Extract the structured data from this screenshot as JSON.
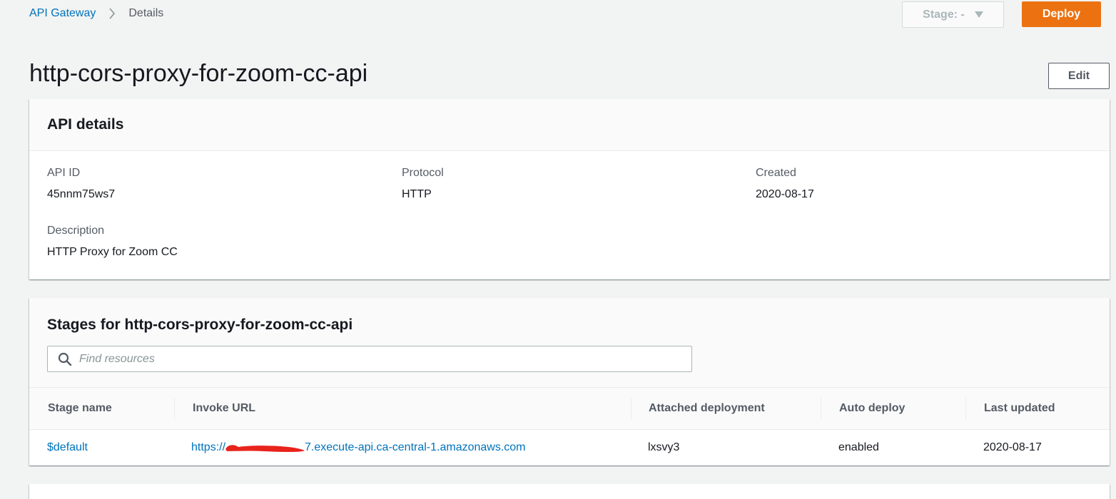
{
  "breadcrumb": {
    "root": "API Gateway",
    "current": "Details"
  },
  "toolbar": {
    "stage_label": "Stage: -",
    "deploy_label": "Deploy"
  },
  "page": {
    "title": "http-cors-proxy-for-zoom-cc-api",
    "edit_label": "Edit"
  },
  "api_details": {
    "title": "API details",
    "api_id_label": "API ID",
    "api_id": "45nnm75ws7",
    "protocol_label": "Protocol",
    "protocol": "HTTP",
    "created_label": "Created",
    "created": "2020-08-17",
    "description_label": "Description",
    "description": "HTTP Proxy for Zoom CC"
  },
  "stages": {
    "title": "Stages for http-cors-proxy-for-zoom-cc-api",
    "search_placeholder": "Find resources",
    "columns": [
      "Stage name",
      "Invoke URL",
      "Attached deployment",
      "Auto deploy",
      "Last updated"
    ],
    "rows": [
      {
        "stage_name": "$default",
        "invoke_url_prefix": "https://",
        "invoke_url_suffix": "7.execute-api.ca-central-1.amazonaws.com",
        "deployment": "lxsvy3",
        "auto_deploy": "enabled",
        "last_updated": "2020-08-17"
      }
    ]
  },
  "icons": {
    "breadcrumb_separator": "chevron-right-icon",
    "stage_dropdown": "caret-down-icon",
    "search": "search-icon"
  },
  "colors": {
    "accent": "#ec7211",
    "link": "#0073bb",
    "redaction": "#e8231c"
  }
}
